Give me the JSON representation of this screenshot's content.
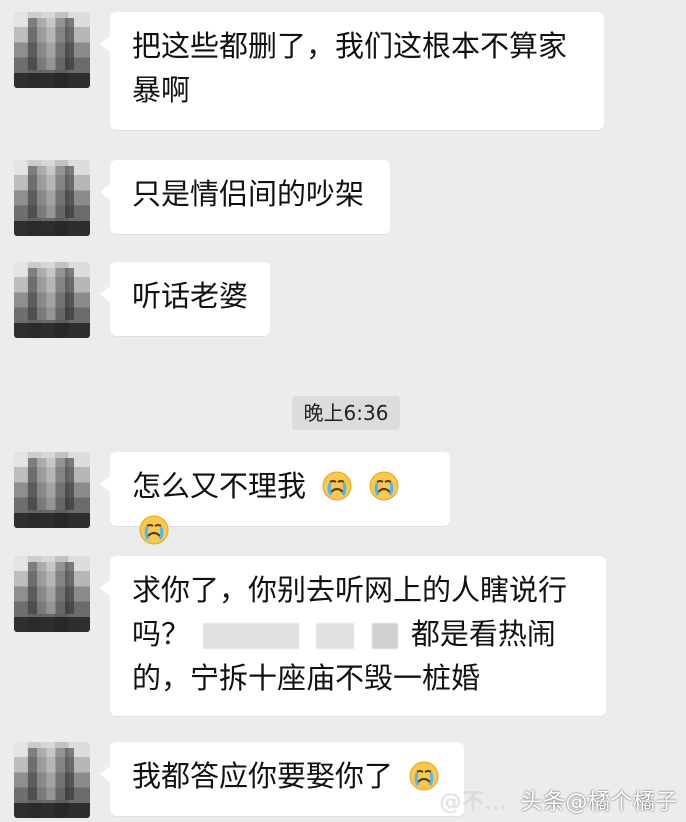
{
  "time_divider": "晚上6:36",
  "messages": [
    {
      "text": "把这些都删了，我们这根本不算家\n暴啊"
    },
    {
      "text": "只是情侣间的吵架"
    },
    {
      "text": "听话老婆"
    },
    {
      "text": "怎么又不理我",
      "emojis": [
        "crying-face",
        "crying-face",
        "crying-face"
      ]
    },
    {
      "text_parts": [
        "求你了，你别去听网上的人瞎说行",
        "吗？",
        "都是看热闹",
        "的，宁拆十座庙不毁一桩婚"
      ]
    },
    {
      "text": "我都答应你要娶你了",
      "emojis": [
        "crying-face"
      ]
    }
  ],
  "watermark": {
    "main": "头条@橘个橘子",
    "faint": "@不..."
  }
}
